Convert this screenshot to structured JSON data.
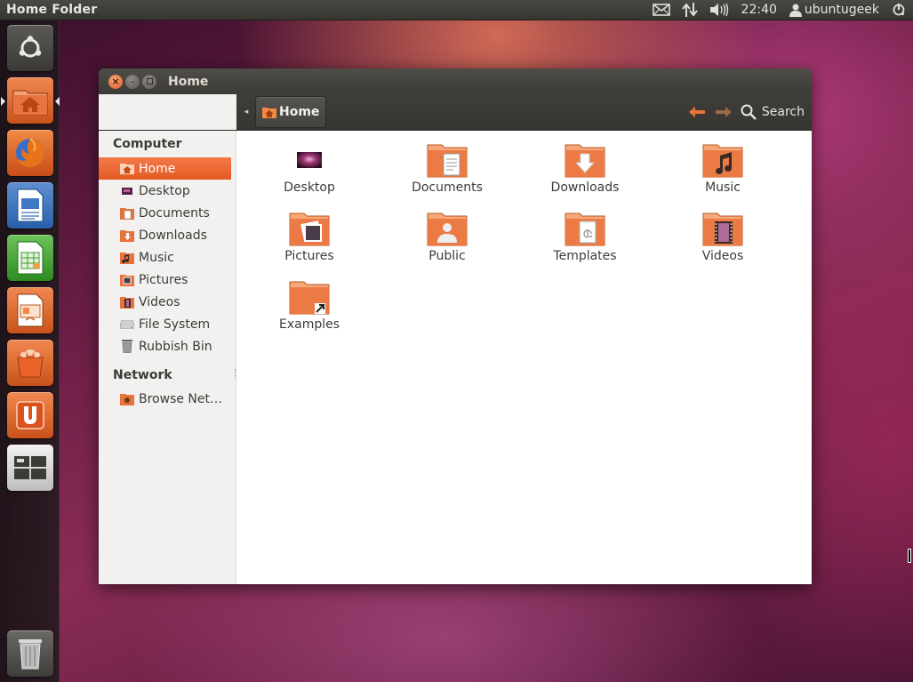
{
  "top_panel": {
    "title": "Home Folder",
    "clock": "22:40",
    "user": "ubuntugeek",
    "indicators": [
      "mail-icon",
      "network-icon",
      "volume-icon",
      "power-icon"
    ]
  },
  "launcher": {
    "items": [
      {
        "name": "dash-home-button",
        "icon": "ubuntu-logo-icon"
      },
      {
        "name": "launcher-home-folder",
        "icon": "home-folder-icon"
      },
      {
        "name": "launcher-firefox",
        "icon": "firefox-icon"
      },
      {
        "name": "launcher-writer",
        "icon": "writer-icon"
      },
      {
        "name": "launcher-calc",
        "icon": "calc-icon"
      },
      {
        "name": "launcher-impress",
        "icon": "impress-icon"
      },
      {
        "name": "launcher-software-center",
        "icon": "software-center-icon"
      },
      {
        "name": "launcher-ubuntu-one",
        "icon": "ubuntu-one-icon"
      },
      {
        "name": "launcher-workspaces",
        "icon": "workspace-switcher-icon"
      },
      {
        "name": "launcher-trash",
        "icon": "trash-icon"
      }
    ]
  },
  "window": {
    "title": "Home",
    "breadcrumb": "Home",
    "search_label": "Search"
  },
  "sidebar": {
    "computer_heading": "Computer",
    "network_heading": "Network",
    "computer_items": [
      {
        "label": "Home",
        "icon": "home-icon",
        "active": true
      },
      {
        "label": "Desktop",
        "icon": "desktop-icon"
      },
      {
        "label": "Documents",
        "icon": "documents-icon"
      },
      {
        "label": "Downloads",
        "icon": "downloads-icon"
      },
      {
        "label": "Music",
        "icon": "music-icon"
      },
      {
        "label": "Pictures",
        "icon": "pictures-icon"
      },
      {
        "label": "Videos",
        "icon": "videos-icon"
      },
      {
        "label": "File System",
        "icon": "drive-icon"
      },
      {
        "label": "Rubbish Bin",
        "icon": "trash-icon"
      }
    ],
    "network_items": [
      {
        "label": "Browse Net…",
        "icon": "network-folder-icon"
      }
    ]
  },
  "files": [
    {
      "label": "Desktop",
      "icon": "desktop-thumbnail-icon"
    },
    {
      "label": "Documents",
      "icon": "documents-folder-icon"
    },
    {
      "label": "Downloads",
      "icon": "downloads-folder-icon"
    },
    {
      "label": "Music",
      "icon": "music-folder-icon"
    },
    {
      "label": "Pictures",
      "icon": "pictures-folder-icon"
    },
    {
      "label": "Public",
      "icon": "public-folder-icon"
    },
    {
      "label": "Templates",
      "icon": "templates-folder-icon"
    },
    {
      "label": "Videos",
      "icon": "videos-folder-icon"
    },
    {
      "label": "Examples",
      "icon": "examples-folder-icon"
    }
  ],
  "colors": {
    "accent": "#e35a24",
    "panel": "#3c3b37",
    "sidebar_bg": "#f2f1f0"
  }
}
